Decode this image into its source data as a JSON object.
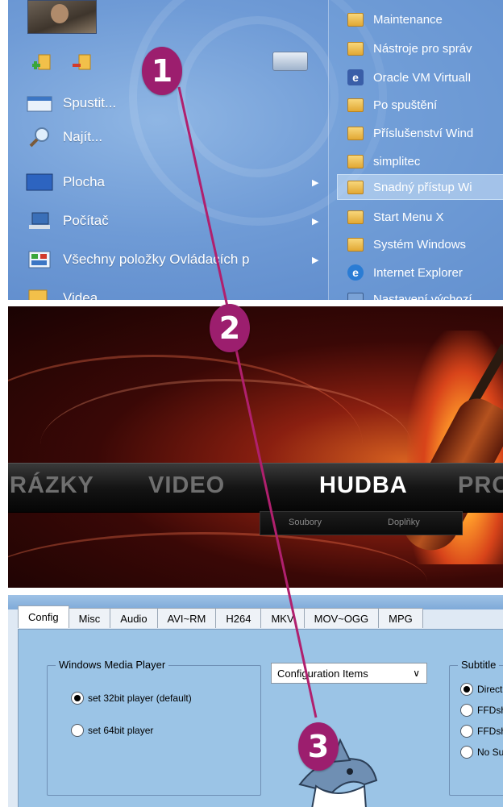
{
  "start_menu": {
    "items": [
      {
        "label": "Spustit...",
        "icon": "run-icon"
      },
      {
        "label": "Najít...",
        "icon": "search-icon"
      },
      {
        "label": "Plocha",
        "icon": "desktop-icon",
        "arrow": "▶"
      },
      {
        "label": "Počítač",
        "icon": "computer-icon",
        "arrow": "▶"
      },
      {
        "label": "Všechny položky Ovládacích p",
        "icon": "control-panel-icon",
        "arrow": "▶"
      },
      {
        "label": "Videa",
        "icon": "videos-icon"
      }
    ],
    "submenu": [
      {
        "label": "Maintenance",
        "icon": "folder-icon"
      },
      {
        "label": "Nástroje pro správ",
        "icon": "folder-icon"
      },
      {
        "label": "Oracle VM VirtualI",
        "icon": "virtualbox-icon"
      },
      {
        "label": "Po spuštění",
        "icon": "folder-icon"
      },
      {
        "label": "Příslušenství Wind",
        "icon": "folder-icon"
      },
      {
        "label": "simplitec",
        "icon": "folder-icon"
      },
      {
        "label": "Snadný přístup Wi",
        "icon": "folder-icon",
        "highlighted": true
      },
      {
        "label": "Start Menu X",
        "icon": "folder-icon"
      },
      {
        "label": "Systém Windows",
        "icon": "folder-icon"
      },
      {
        "label": "Internet Explorer",
        "icon": "ie-icon"
      },
      {
        "label": "Nastavení výchozí",
        "icon": "settings-icon"
      }
    ]
  },
  "media_center": {
    "menu": [
      {
        "label": "RÁZKY",
        "active": false
      },
      {
        "label": "VIDEO",
        "active": false
      },
      {
        "label": "HUDBA",
        "active": true
      },
      {
        "label": "PRO",
        "active": false
      }
    ],
    "submenu": [
      "Soubory",
      "Doplňky"
    ]
  },
  "settings_dialog": {
    "tabs": [
      "Config",
      "Misc",
      "Audio",
      "AVI~RM",
      "H264",
      "MKV",
      "MOV~OGG",
      "MPG"
    ],
    "active_tab": "Config",
    "wmp_group": {
      "title": "Windows Media Player",
      "options": [
        {
          "label": "set 32bit player (default)",
          "checked": true
        },
        {
          "label": "set 64bit player",
          "checked": false
        }
      ]
    },
    "config_select": {
      "value": "Configuration Items",
      "chevron": "∨"
    },
    "subtitle_group": {
      "title": "Subtitle",
      "options": [
        {
          "label": "Direct",
          "checked": true
        },
        {
          "label": "FFDsh",
          "checked": false
        },
        {
          "label": "FFDsh",
          "checked": false
        },
        {
          "label": "No Su",
          "checked": false
        }
      ]
    }
  },
  "badges": [
    "1",
    "2",
    "3"
  ],
  "colors": {
    "badge": "#9c1e6e",
    "connector_line": "#b0206e"
  }
}
